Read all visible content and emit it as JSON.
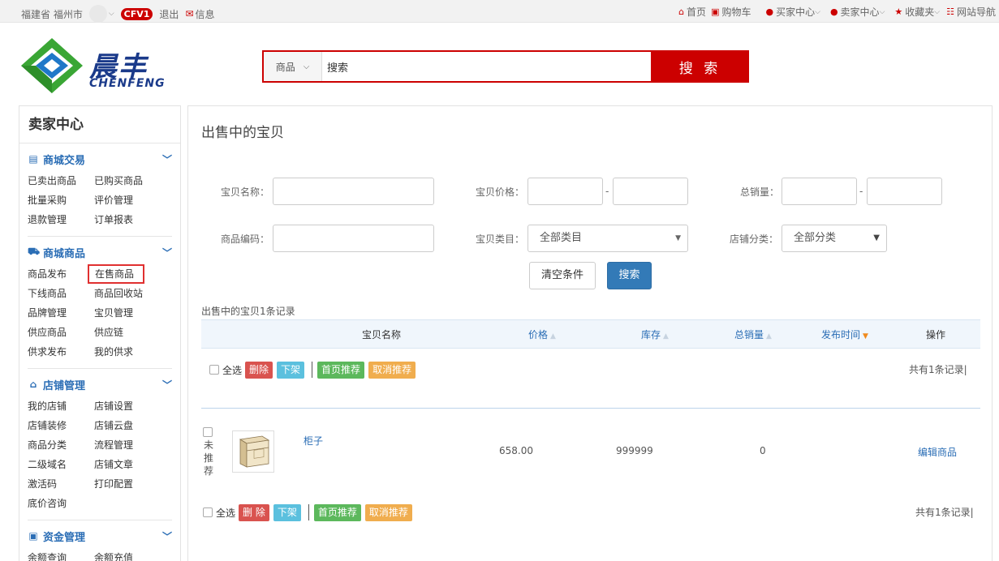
{
  "topbar": {
    "location": "福建省 福州市",
    "badge": "CFV1",
    "logout": "退出",
    "messages": "信息",
    "nav": [
      {
        "label": "首页",
        "icon": "home-icon"
      },
      {
        "label": "购物车",
        "icon": "cart-icon"
      },
      {
        "label": "买家中心",
        "icon": "user-icon"
      },
      {
        "label": "卖家中心",
        "icon": "user-icon"
      },
      {
        "label": "收藏夹",
        "icon": "star-icon"
      },
      {
        "label": "网站导航",
        "icon": "grid-icon"
      }
    ]
  },
  "brand": {
    "name_cn": "晨丰",
    "name_en": "CHENFENG"
  },
  "search": {
    "scope": "商品",
    "value": "搜索",
    "button": "搜 索"
  },
  "sidebar": {
    "title": "卖家中心",
    "sections": [
      {
        "title": "商城交易",
        "icon": "list-icon",
        "items": [
          "已卖出商品",
          "已购买商品",
          "批量采购",
          "评价管理",
          "退款管理",
          "订单报表"
        ]
      },
      {
        "title": "商城商品",
        "icon": "truck-icon",
        "items": [
          "商品发布",
          "在售商品",
          "下线商品",
          "商品回收站",
          "品牌管理",
          "宝贝管理",
          "供应商品",
          "供应链",
          "供求发布",
          "我的供求"
        ]
      },
      {
        "title": "店铺管理",
        "icon": "home-icon",
        "items": [
          "我的店铺",
          "店铺设置",
          "店铺装修",
          "店铺云盘",
          "商品分类",
          "流程管理",
          "二级域名",
          "店铺文章",
          "激活码",
          "打印配置",
          "底价咨询"
        ]
      },
      {
        "title": "资金管理",
        "icon": "money-icon",
        "items": [
          "余额查询",
          "余额充值"
        ]
      }
    ]
  },
  "main": {
    "title": "出售中的宝贝",
    "filters": {
      "name_label": "宝贝名称：",
      "price_label": "宝贝价格：",
      "sales_label": "总销量：",
      "code_label": "商品编码：",
      "category_label": "宝贝类目：",
      "category_value": "全部类目",
      "shopcat_label": "店铺分类：",
      "shopcat_value": "全部分类",
      "dash": "-",
      "clear_button": "清空条件",
      "search_button": "搜索"
    },
    "records_note": "出售中的宝贝1条记录",
    "columns": [
      "宝贝名称",
      "价格",
      "库存",
      "总销量",
      "发布时间",
      "操作"
    ],
    "bulk": {
      "select_all": "全选",
      "delete_top": "删除",
      "delete_bottom": "删 除",
      "offline": "下架",
      "recommend": "首页推荐",
      "unrecommend": "取消推荐",
      "total": "共有1条记录|"
    },
    "row": {
      "tag": "未推荐",
      "name": "柜子",
      "price": "658.00",
      "stock": "999999",
      "sales": "0",
      "action": "编辑商品"
    }
  }
}
